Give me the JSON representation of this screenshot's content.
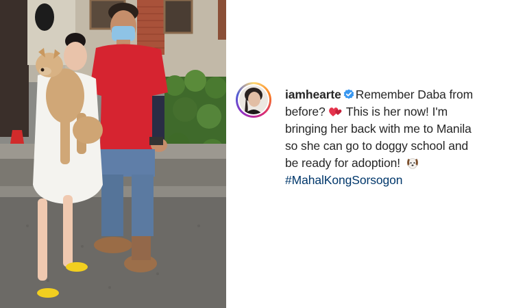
{
  "post": {
    "username": "iamhearte",
    "caption_lines": [
      "Remember Daba from",
      "before? ",
      " This is her now! I'm",
      "bringing her back with me to Manila",
      "so she can go to doggy school and",
      "be ready for adoption! "
    ],
    "hashtag": "#MahalKongSorsogon",
    "icons": {
      "verified": "verified-badge-icon",
      "heart": "two-hearts-emoji-icon",
      "dog": "dog-face-emoji-icon"
    },
    "colors": {
      "hashtag": "#00376b",
      "verified": "#3897f0",
      "text": "#262626"
    }
  }
}
